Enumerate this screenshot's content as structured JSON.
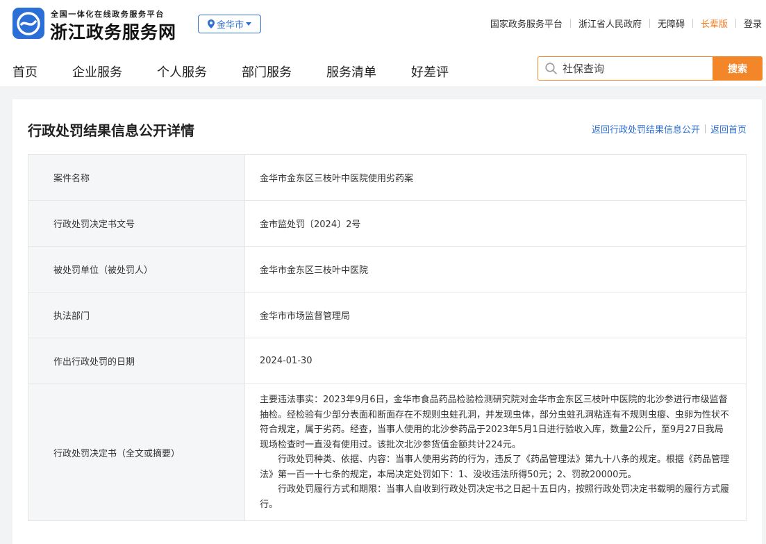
{
  "header": {
    "logo_subtitle": "全国一体化在线政务服务平台",
    "logo_title": "浙江政务服务网",
    "city": "金华市",
    "top_links": [
      "国家政务服务平台",
      "浙江省人民政府",
      "无障碍",
      "长辈版",
      "登录"
    ],
    "nav": [
      "首页",
      "企业服务",
      "个人服务",
      "部门服务",
      "服务清单",
      "好差评"
    ],
    "search": {
      "placeholder": "社保查询",
      "button": "搜索"
    }
  },
  "colors": {
    "brand_blue": "#2f6fd4",
    "accent_orange": "#f4862a",
    "elder_orange": "#f47a20"
  },
  "icons": {
    "logo": "zhejiang-logo-icon",
    "location": "location-pin-icon",
    "dropdown": "caret-down-icon",
    "search": "search-icon"
  },
  "page": {
    "title": "行政处罚结果信息公开详情",
    "back_list": "返回行政处罚结果信息公开",
    "back_home": "返回首页"
  },
  "rows": [
    {
      "label": "案件名称",
      "value": "金华市金东区三枝叶中医院使用劣药案"
    },
    {
      "label": "行政处罚决定书文号",
      "value": "金市监处罚〔2024〕2号"
    },
    {
      "label": "被处罚单位（被处罚人）",
      "value": "金华市金东区三枝叶中医院"
    },
    {
      "label": "执法部门",
      "value": "金华市市场监督管理局"
    },
    {
      "label": "作出行政处罚的日期",
      "value": "2024-01-30"
    }
  ],
  "decision": {
    "label": "行政处罚决定书（全文或摘要）",
    "paragraphs": [
      "主要违法事实：2023年9月6日，金华市食品药品检验检测研究院对金华市金东区三枝叶中医院的北沙参进行市级监督抽检。经检验有少部分表面和断面存在不规则虫蛀孔洞，并发现虫体，部分虫蛀孔洞粘连有不规则虫瘿、虫卵为性状不符合规定，属于劣药。经查，当事人使用的北沙参药品于2023年5月1日进行验收入库，数量2公斤，至9月27日我局现场检查时一直没有使用过。该批次北沙参货值金额共计224元。",
      "行政处罚种类、依据、内容：当事人使用劣药的行为，违反了《药品管理法》第九十八条的规定。根据《药品管理法》第一百一十七条的规定，本局决定处罚如下：1、没收违法所得50元；2、罚款20000元。",
      "行政处罚履行方式和期限：当事人自收到行政处罚决定书之日起十五日内，按照行政处罚决定书载明的履行方式履行。"
    ]
  }
}
